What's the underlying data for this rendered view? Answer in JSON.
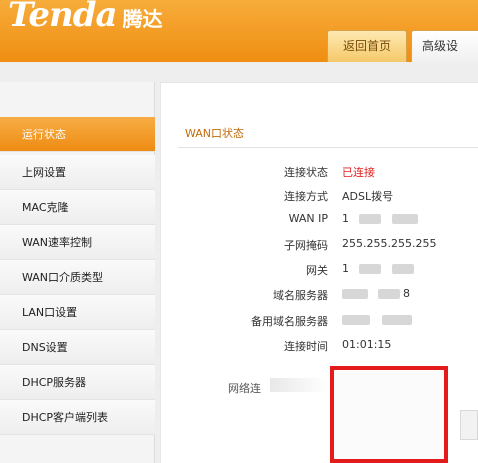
{
  "brand": {
    "logo_en": "Tenda",
    "logo_cn": "腾达"
  },
  "tabs": [
    {
      "label": "返回首页"
    },
    {
      "label": "高级设"
    }
  ],
  "sidebar": {
    "items": [
      {
        "label": "运行状态",
        "active": true
      },
      {
        "label": "上网设置"
      },
      {
        "label": "MAC克隆"
      },
      {
        "label": "WAN速率控制"
      },
      {
        "label": "WAN口介质类型"
      },
      {
        "label": "LAN口设置"
      },
      {
        "label": "DNS设置"
      },
      {
        "label": "DHCP服务器"
      },
      {
        "label": "DHCP客户端列表"
      }
    ]
  },
  "wan": {
    "title": "WAN口状态",
    "rows": [
      {
        "label": "连接状态",
        "value": "已连接"
      },
      {
        "label": "连接方式",
        "value": "ADSL拨号"
      },
      {
        "label": "WAN IP",
        "value": "1"
      },
      {
        "label": "子网掩码",
        "value": "255.255.255.255"
      },
      {
        "label": "网关",
        "value": "1"
      },
      {
        "label": "域名服务器",
        "value": "8"
      },
      {
        "label": "备用域名服务器",
        "value": ""
      },
      {
        "label": "连接时间",
        "value": "01:01:15"
      }
    ]
  },
  "network": {
    "label": "网络连"
  },
  "colors": {
    "brand_orange": "#f39a1f",
    "status_connected": "#e02020",
    "highlight_box": "#e31b1b"
  }
}
